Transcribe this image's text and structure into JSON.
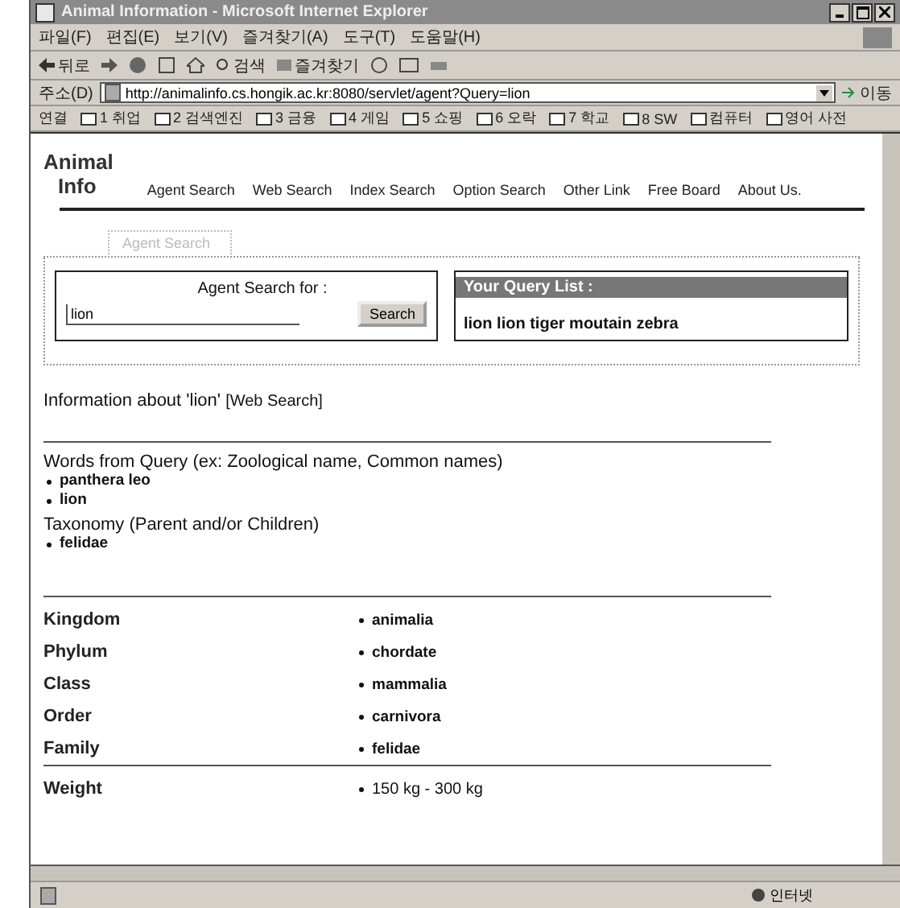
{
  "window": {
    "title": "Animal Information - Microsoft Internet Explorer"
  },
  "menu": [
    "파일(F)",
    "편집(E)",
    "보기(V)",
    "즐겨찾기(A)",
    "도구(T)",
    "도움말(H)"
  ],
  "toolbar": [
    "뒤로",
    "검색",
    "즐겨찾기"
  ],
  "address": {
    "label": "주소(D)",
    "value": "http://animalinfo.cs.hongik.ac.kr:8080/servlet/agent?Query=lion",
    "go": "이동"
  },
  "links": {
    "label": "연결",
    "items": [
      "1 취업",
      "2 검색엔진",
      "3 금융",
      "4 게임",
      "5 쇼핑",
      "6 오락",
      "7 학교",
      "8 SW",
      "컴퓨터",
      "영어 사전"
    ]
  },
  "site": {
    "logo": [
      "Animal",
      "Info"
    ],
    "nav": [
      "Agent Search",
      "Web Search",
      "Index Search",
      "Option Search",
      "Other Link",
      "Free Board",
      "About Us."
    ],
    "tab": "Agent Search",
    "search": {
      "label": "Agent Search for :",
      "value": "lion",
      "button": "Search"
    },
    "query_list": {
      "title": "Your Query List :",
      "text": "lion lion tiger moutain zebra"
    },
    "heading": "Information about 'lion'",
    "heading_tag": "[Web Search]",
    "sections": [
      {
        "title": "Words from Query (ex: Zoological name, Common names)",
        "items": [
          "panthera leo",
          "lion"
        ]
      },
      {
        "title": "Taxonomy (Parent and/or Children)",
        "items": [
          "felidae"
        ]
      }
    ],
    "taxonomy": [
      {
        "label": "Kingdom",
        "value": "animalia"
      },
      {
        "label": "Phylum",
        "value": "chordate"
      },
      {
        "label": "Class",
        "value": "mammalia"
      },
      {
        "label": "Order",
        "value": "carnivora"
      },
      {
        "label": "Family",
        "value": "felidae"
      }
    ],
    "facts": [
      {
        "label": "Weight",
        "value": "150 kg - 300 kg"
      }
    ]
  },
  "status_bar": {
    "zone": "인터넷"
  }
}
